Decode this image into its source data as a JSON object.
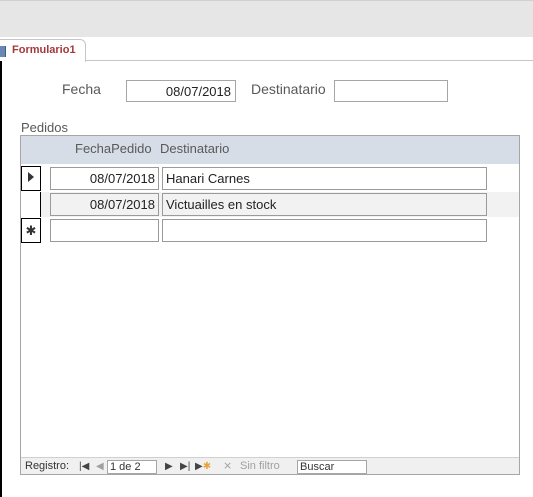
{
  "tab": {
    "label": "Formulario1",
    "icon": "form-icon"
  },
  "form": {
    "fecha_label": "Fecha",
    "fecha_value": "08/07/2018",
    "destinatario_label": "Destinatario",
    "destinatario_value": ""
  },
  "subform": {
    "label": "Pedidos",
    "columns": [
      "FechaPedido",
      "Destinatario"
    ],
    "rows": [
      {
        "selector": "current",
        "fecha": "08/07/2018",
        "destinatario": "Hanari Carnes"
      },
      {
        "selector": "",
        "fecha": "08/07/2018",
        "destinatario": "Victuailles en stock"
      },
      {
        "selector": "new",
        "fecha": "",
        "destinatario": ""
      }
    ]
  },
  "navigation": {
    "record_label": "Registro:",
    "first_icon": "first-record-icon",
    "prev_icon": "previous-record-icon",
    "position": "1 de 2",
    "next_icon": "next-record-icon",
    "last_icon": "last-record-icon",
    "new_icon": "new-record-icon",
    "filter_icon": "no-filter-icon",
    "filter_label": "Sin filtro",
    "search_value": "Buscar"
  }
}
